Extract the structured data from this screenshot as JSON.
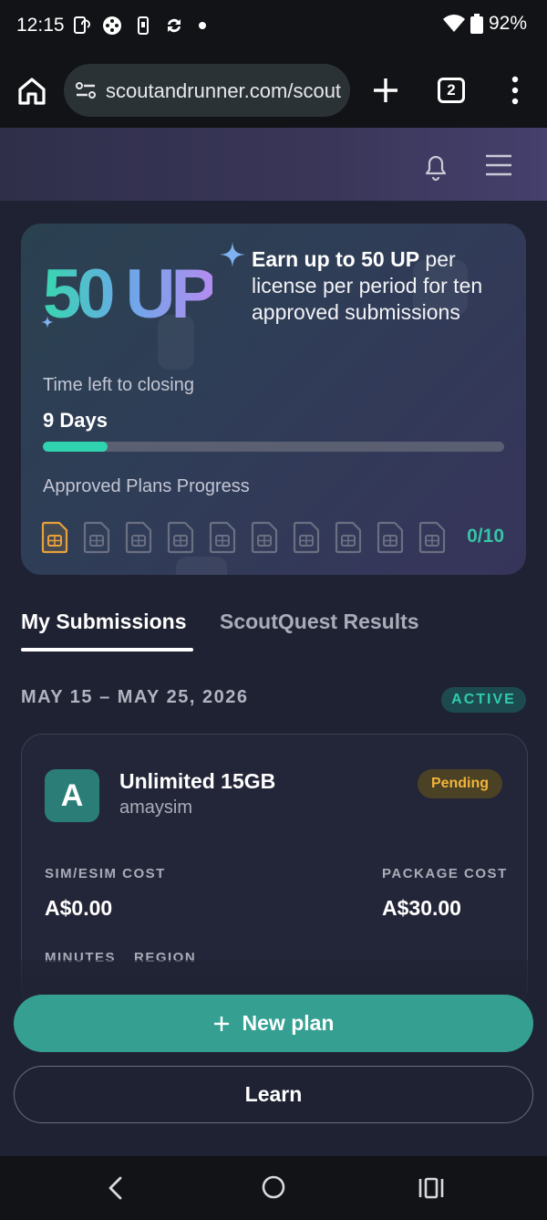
{
  "status_bar": {
    "time": "12:15",
    "battery": "92%"
  },
  "browser": {
    "url": "scoutandrunner.com/scout",
    "tab_count": "2"
  },
  "promo": {
    "big_text": "50 UP",
    "headline_bold": "Earn up to 50 UP",
    "headline_rest": " per license per period for ten approved submissions",
    "time_left_label": "Time left to closing",
    "days_left": "9 Days",
    "time_progress": 0.14,
    "approved_label": "Approved Plans Progress",
    "approved_count": "0/10",
    "sim_slots": 10,
    "sim_highlighted": 1
  },
  "tabs": [
    {
      "label": "My Submissions",
      "active": true
    },
    {
      "label": "ScoutQuest Results",
      "active": false
    }
  ],
  "period": {
    "range": "MAY 15 – MAY 25, 2026",
    "status": "ACTIVE"
  },
  "submission": {
    "initial": "A",
    "plan_name": "Unlimited 15GB",
    "provider": "amaysim",
    "status": "Pending",
    "sim_cost_label": "SIM/ESIM COST",
    "sim_cost": "A$0.00",
    "package_cost_label": "PACKAGE COST",
    "package_cost": "A$30.00",
    "minutes_label": "MINUTES",
    "region_label": "REGION"
  },
  "actions": {
    "new_plan": "New plan",
    "learn": "Learn"
  },
  "colors": {
    "accent": "#35a092",
    "progress": "#2fd3b0",
    "pending": "#f2b43a",
    "sim_active": "#e8a13a"
  }
}
